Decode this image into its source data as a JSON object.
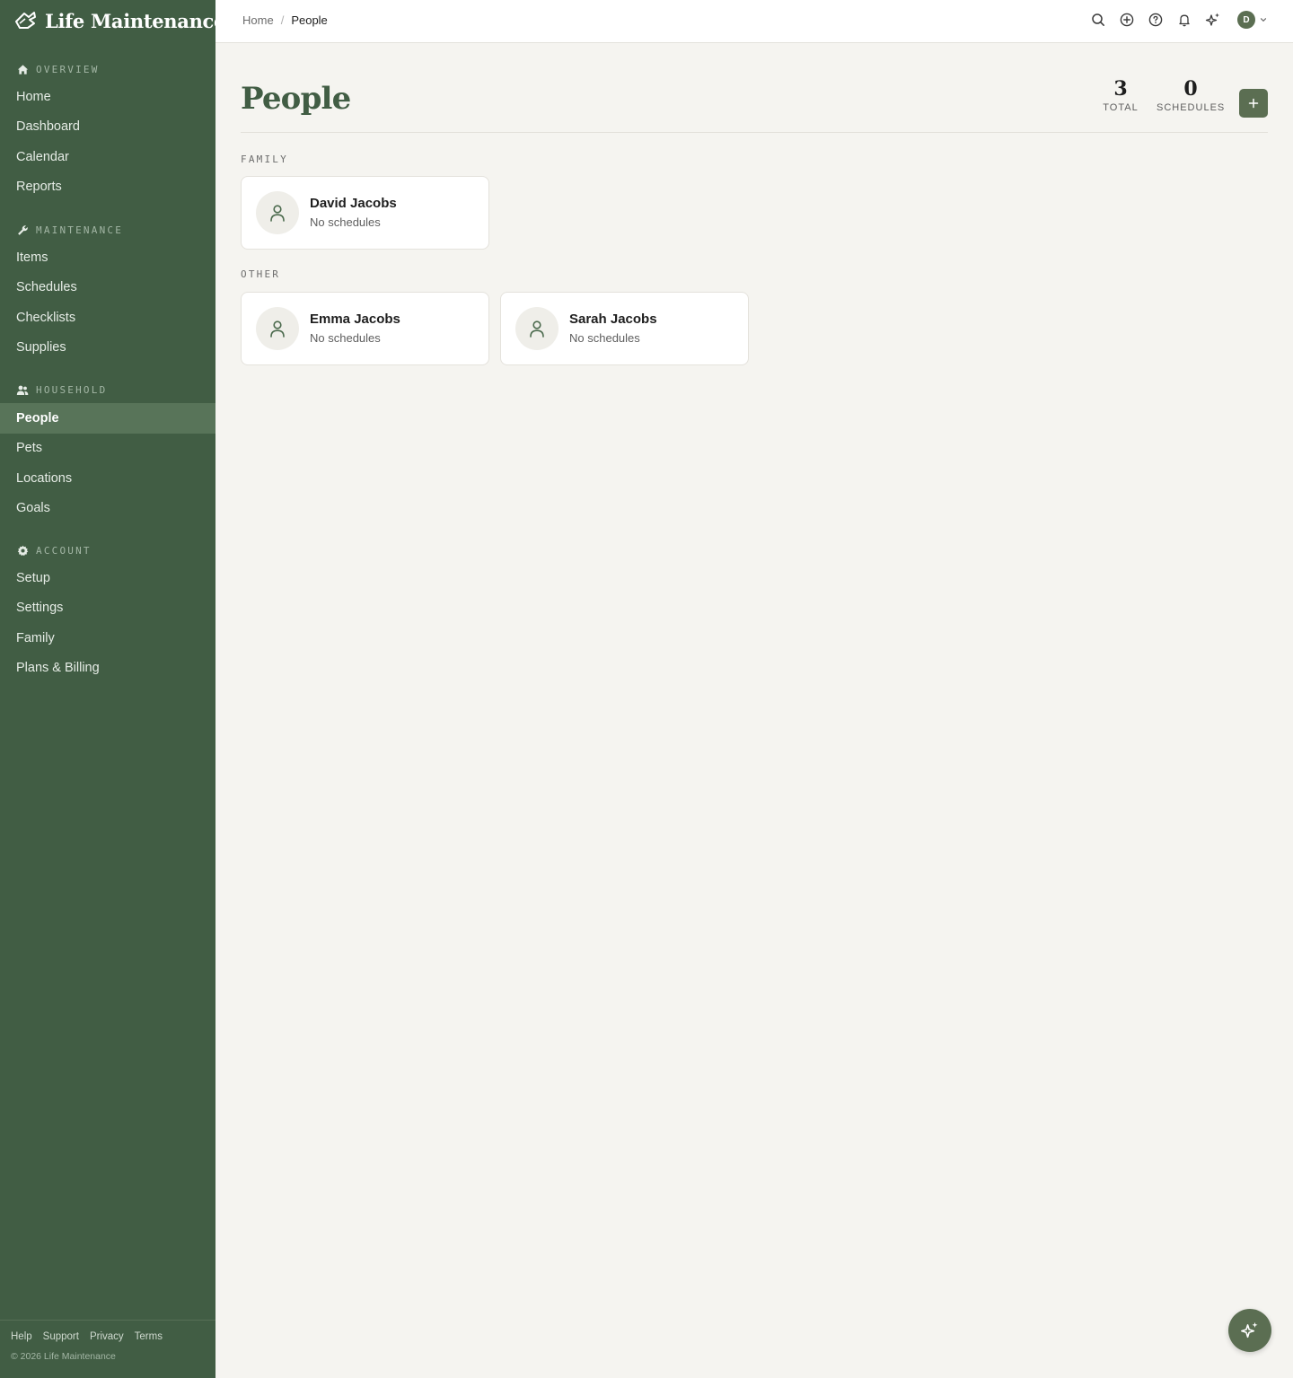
{
  "app": {
    "name": "Life Maintenance"
  },
  "sidebar": {
    "sections": [
      {
        "label": "OVERVIEW",
        "icon": "home-icon",
        "items": [
          "Home",
          "Dashboard",
          "Calendar",
          "Reports"
        ]
      },
      {
        "label": "MAINTENANCE",
        "icon": "wrench-icon",
        "items": [
          "Items",
          "Schedules",
          "Checklists",
          "Supplies"
        ]
      },
      {
        "label": "HOUSEHOLD",
        "icon": "users-icon",
        "items": [
          "People",
          "Pets",
          "Locations",
          "Goals"
        ]
      },
      {
        "label": "ACCOUNT",
        "icon": "gear-icon",
        "items": [
          "Setup",
          "Settings",
          "Family",
          "Plans & Billing"
        ]
      }
    ],
    "active_item": "People",
    "footer": {
      "links": [
        "Help",
        "Support",
        "Privacy",
        "Terms"
      ],
      "copyright": "© 2026 Life Maintenance"
    }
  },
  "topbar": {
    "breadcrumb": {
      "home": "Home",
      "separator": "/",
      "current": "People"
    },
    "icons": [
      "search-icon",
      "plus-circle-icon",
      "help-icon",
      "bell-icon",
      "sparkles-icon"
    ],
    "avatar_initial": "D"
  },
  "main": {
    "title": "People",
    "stats": [
      {
        "value": "3",
        "label": "TOTAL"
      },
      {
        "value": "0",
        "label": "SCHEDULES"
      }
    ],
    "add_button_icon": "plus-icon",
    "groups": [
      {
        "label": "FAMILY",
        "people": [
          {
            "name": "David Jacobs",
            "subtitle": "No schedules"
          }
        ]
      },
      {
        "label": "OTHER",
        "people": [
          {
            "name": "Emma Jacobs",
            "subtitle": "No schedules"
          },
          {
            "name": "Sarah Jacobs",
            "subtitle": "No schedules"
          }
        ]
      }
    ]
  },
  "fab": {
    "icon": "sparkles-icon"
  },
  "colors": {
    "sidebar_bg": "#415d44",
    "sidebar_active": "#587459",
    "accent": "#5b6e52",
    "page_bg": "#f5f4f0"
  }
}
